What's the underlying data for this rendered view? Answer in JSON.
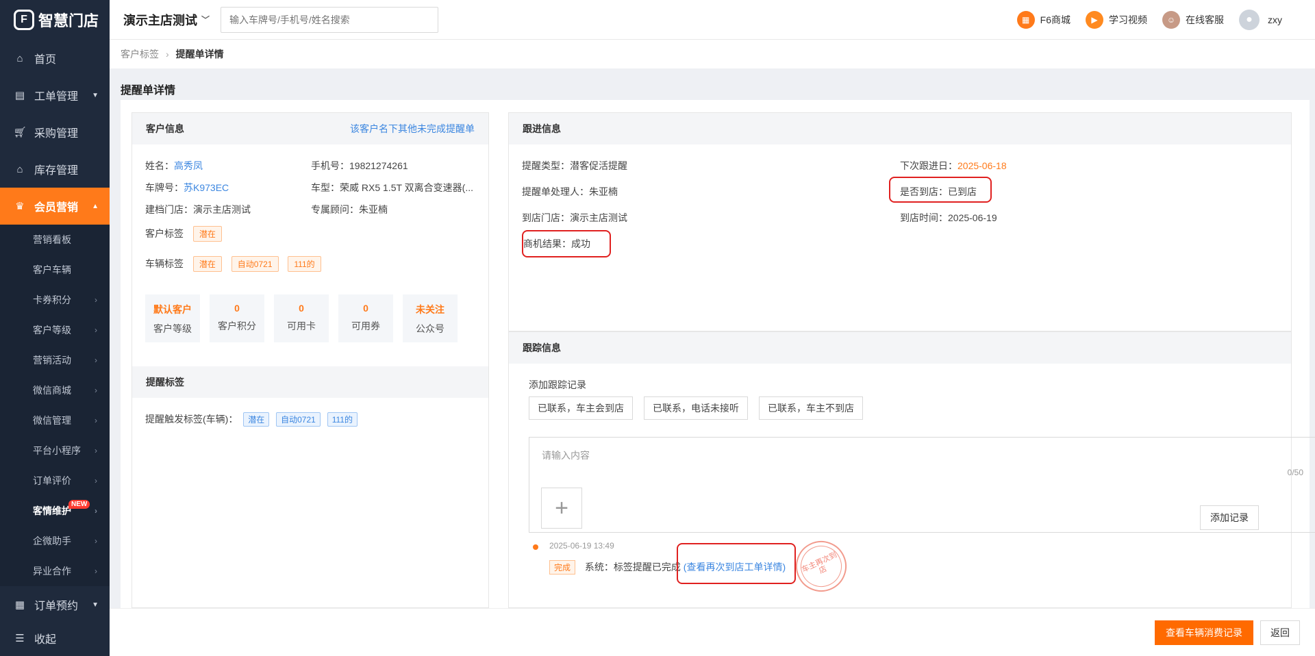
{
  "app": {
    "logo_text": "智慧门店",
    "logo_glyph": "F"
  },
  "sidebar": {
    "items": [
      {
        "label": "首页",
        "icon": "home-icon"
      },
      {
        "label": "工单管理",
        "icon": "document-icon"
      },
      {
        "label": "采购管理",
        "icon": "cart-icon"
      },
      {
        "label": "库存管理",
        "icon": "warehouse-icon"
      },
      {
        "label": "会员营销",
        "icon": "crown-icon"
      }
    ],
    "sub_items": [
      {
        "label": "营销看板"
      },
      {
        "label": "客户车辆"
      },
      {
        "label": "卡券积分"
      },
      {
        "label": "客户等级"
      },
      {
        "label": "营销活动"
      },
      {
        "label": "微信商城"
      },
      {
        "label": "微信管理"
      },
      {
        "label": "平台小程序"
      },
      {
        "label": "订单评价"
      },
      {
        "label": "客情维护",
        "badge": "NEW"
      },
      {
        "label": "企微助手"
      },
      {
        "label": "异业合作"
      }
    ],
    "bottom_items": [
      {
        "label": "订单预约",
        "icon": "calendar-icon"
      },
      {
        "label": "收起",
        "icon": "collapse-icon"
      }
    ]
  },
  "header": {
    "store_name": "演示主店测试",
    "search_placeholder": "输入车牌号/手机号/姓名搜索",
    "mall": "F6商城",
    "video": "学习视频",
    "service": "在线客服",
    "user": "zxy"
  },
  "breadcrumb": {
    "parent": "客户标签",
    "current": "提醒单详情"
  },
  "page_title": "提醒单详情",
  "customer": {
    "title": "客户信息",
    "link": "该客户名下其他未完成提醒单",
    "name_label": "姓名：",
    "name": "高秀凤",
    "phone_label": "手机号：",
    "phone": "19821274261",
    "plate_label": "车牌号：",
    "plate": "苏K973EC",
    "model_label": "车型：",
    "model": "荣威 RX5 1.5T 双离合变速器(...",
    "store_label": "建档门店：",
    "store": "演示主店测试",
    "advisor_label": "专属顾问：",
    "advisor": "朱亚楠",
    "cust_tag_label": "客户标签",
    "cust_tags": [
      "潜在"
    ],
    "car_tag_label": "车辆标签",
    "car_tags": [
      "潜在",
      "自动0721",
      "111的"
    ],
    "stats": [
      {
        "num": "默认客户",
        "label": "客户等级"
      },
      {
        "num": "0",
        "label": "客户积分"
      },
      {
        "num": "0",
        "label": "可用卡"
      },
      {
        "num": "0",
        "label": "可用券"
      },
      {
        "num": "未关注",
        "label": "公众号"
      }
    ]
  },
  "reminder_tags": {
    "title": "提醒标签",
    "trigger_label": "提醒触发标签(车辆)：",
    "tags": [
      "潜在",
      "自动0721",
      "111的"
    ]
  },
  "follow": {
    "title": "跟进信息",
    "type_label": "提醒类型：",
    "type": "潜客促活提醒",
    "next_label": "下次跟进日：",
    "next": "2025-06-18",
    "handler_label": "提醒单处理人：",
    "handler": "朱亚楠",
    "arrived_label": "是否到店：",
    "arrived": "已到店",
    "arrive_store_label": "到店门店：",
    "arrive_store": "演示主店测试",
    "arrive_time_label": "到店时间：",
    "arrive_time": "2025-06-19",
    "result_label": "商机结果：",
    "result": "成功"
  },
  "tracking": {
    "title": "跟踪信息",
    "add_label": "添加跟踪记录",
    "quick": [
      "已联系，车主会到店",
      "已联系，电话未接听",
      "已联系，车主不到店"
    ],
    "input_placeholder": "请输入内容",
    "counter": "0/50",
    "add_button": "添加记录",
    "record_time": "2025-06-19 13:49",
    "record_tag": "完成",
    "record_text": "系统：标签提醒已完成",
    "record_link": "(查看再次到店工单详情)",
    "stamp": "车主再次到店"
  },
  "footer": {
    "primary": "查看车辆消费记录",
    "back": "返回"
  }
}
